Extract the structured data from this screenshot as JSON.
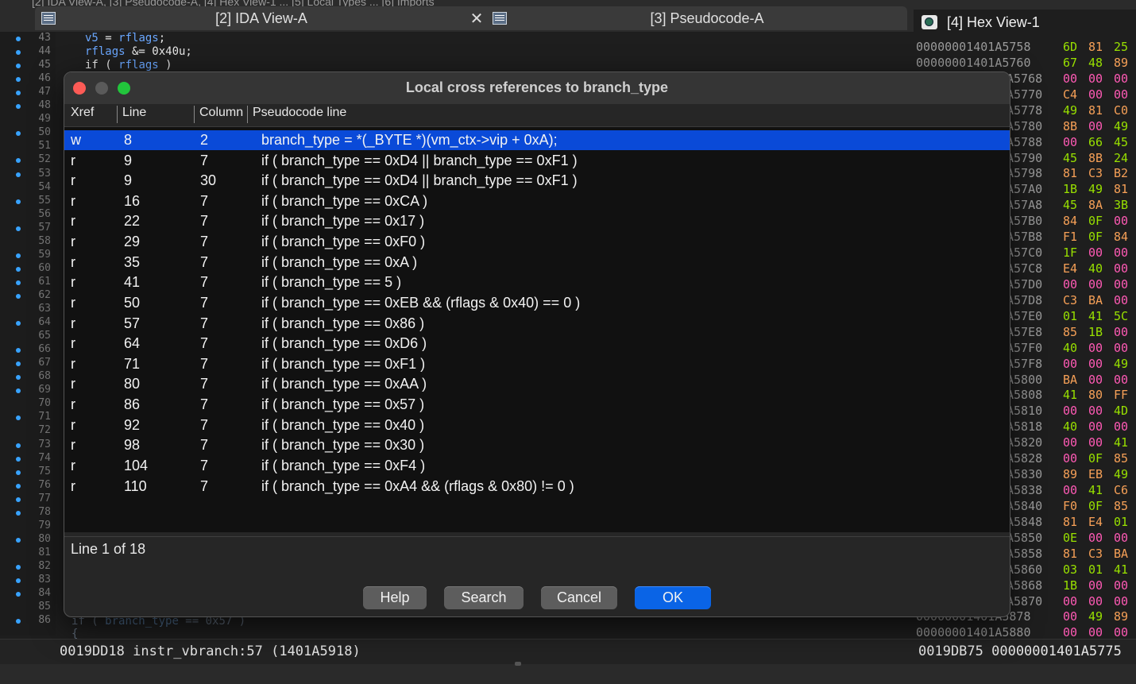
{
  "tabs": {
    "cutoff_text": "[2] IDA View-A, [3] Pseudocode-A, [4] Hex View-1  ...  [5] Local Types  ...  [6] Imports",
    "ida_view": "[2] IDA View-A",
    "pseudocode": "[3] Pseudocode-A",
    "hex_view": "[4] Hex View-1",
    "close_glyph": "✕"
  },
  "gutter": {
    "lines": [
      "43",
      "44",
      "45",
      "46",
      "47",
      "48",
      "49",
      "50",
      "51",
      "52",
      "53",
      "54",
      "55",
      "56",
      "57",
      "58",
      "59",
      "60",
      "61",
      "62",
      "63",
      "64",
      "65",
      "66",
      "67",
      "68",
      "69",
      "70",
      "71",
      "72",
      "73",
      "74",
      "75",
      "76",
      "77",
      "78",
      "79",
      "80",
      "81",
      "82",
      "83",
      "84",
      "85",
      "86"
    ],
    "breakpoints": [
      "43",
      "44",
      "45",
      "46",
      "47",
      "48",
      "50",
      "52",
      "53",
      "55",
      "57",
      "59",
      "60",
      "61",
      "62",
      "64",
      "66",
      "67",
      "68",
      "69",
      "71",
      "73",
      "74",
      "75",
      "76",
      "77",
      "78",
      "80",
      "82",
      "83",
      "84",
      "86"
    ]
  },
  "code_top": [
    {
      "parts": [
        {
          "t": "v5",
          "c": "kw"
        },
        {
          "t": " = ",
          "c": "id"
        },
        {
          "t": "rflags",
          "c": "kw"
        },
        {
          "t": ";",
          "c": "id"
        }
      ]
    },
    {
      "parts": [
        {
          "t": "rflags",
          "c": "kw"
        },
        {
          "t": " &= 0x40u;",
          "c": "id"
        }
      ]
    },
    {
      "parts": [
        {
          "t": "if ( ",
          "c": "id"
        },
        {
          "t": "rflags",
          "c": "kw"
        },
        {
          "t": " )",
          "c": "id"
        }
      ]
    }
  ],
  "code_bottom": {
    "l1_prefix": "if ( ",
    "l1_var": "branch_type",
    "l1_suffix": " == 0x57 )",
    "l2": "{"
  },
  "hex": {
    "rows": [
      {
        "addr": "00000001401A5758",
        "bytes": [
          "6D",
          "81",
          "25"
        ]
      },
      {
        "addr": "00000001401A5760",
        "bytes": [
          "67",
          "48",
          "89"
        ]
      },
      {
        "addr": "A5768",
        "bytes": [
          "00",
          "00",
          "00"
        ]
      },
      {
        "addr": "A5770",
        "bytes": [
          "C4",
          "00",
          "00"
        ]
      },
      {
        "addr": "A5778",
        "bytes": [
          "49",
          "81",
          "C0"
        ]
      },
      {
        "addr": "A5780",
        "bytes": [
          "8B",
          "00",
          "49"
        ]
      },
      {
        "addr": "A5788",
        "bytes": [
          "00",
          "66",
          "45"
        ]
      },
      {
        "addr": "A5790",
        "bytes": [
          "45",
          "8B",
          "24"
        ]
      },
      {
        "addr": "A5798",
        "bytes": [
          "81",
          "C3",
          "B2"
        ]
      },
      {
        "addr": "A57A0",
        "bytes": [
          "1B",
          "49",
          "81"
        ]
      },
      {
        "addr": "A57A8",
        "bytes": [
          "45",
          "8A",
          "3B"
        ]
      },
      {
        "addr": "A57B0",
        "bytes": [
          "84",
          "0F",
          "00"
        ]
      },
      {
        "addr": "A57B8",
        "bytes": [
          "F1",
          "0F",
          "84"
        ]
      },
      {
        "addr": "A57C0",
        "bytes": [
          "1F",
          "00",
          "00"
        ]
      },
      {
        "addr": "A57C8",
        "bytes": [
          "E4",
          "40",
          "00"
        ]
      },
      {
        "addr": "A57D0",
        "bytes": [
          "00",
          "00",
          "00"
        ]
      },
      {
        "addr": "A57D8",
        "bytes": [
          "C3",
          "BA",
          "00"
        ]
      },
      {
        "addr": "A57E0",
        "bytes": [
          "01",
          "41",
          "5C"
        ]
      },
      {
        "addr": "A57E8",
        "bytes": [
          "85",
          "1B",
          "00"
        ]
      },
      {
        "addr": "A57F0",
        "bytes": [
          "40",
          "00",
          "00"
        ]
      },
      {
        "addr": "A57F8",
        "bytes": [
          "00",
          "00",
          "49"
        ]
      },
      {
        "addr": "A5800",
        "bytes": [
          "BA",
          "00",
          "00"
        ]
      },
      {
        "addr": "A5808",
        "bytes": [
          "41",
          "80",
          "FF"
        ]
      },
      {
        "addr": "A5810",
        "bytes": [
          "00",
          "00",
          "4D"
        ]
      },
      {
        "addr": "A5818",
        "bytes": [
          "40",
          "00",
          "00"
        ]
      },
      {
        "addr": "A5820",
        "bytes": [
          "00",
          "00",
          "41"
        ]
      },
      {
        "addr": "A5828",
        "bytes": [
          "00",
          "0F",
          "85"
        ]
      },
      {
        "addr": "A5830",
        "bytes": [
          "89",
          "EB",
          "49"
        ]
      },
      {
        "addr": "A5838",
        "bytes": [
          "00",
          "41",
          "C6"
        ]
      },
      {
        "addr": "A5840",
        "bytes": [
          "F0",
          "0F",
          "85"
        ]
      },
      {
        "addr": "A5848",
        "bytes": [
          "81",
          "E4",
          "01"
        ]
      },
      {
        "addr": "A5850",
        "bytes": [
          "0E",
          "00",
          "00"
        ]
      },
      {
        "addr": "A5858",
        "bytes": [
          "81",
          "C3",
          "BA"
        ]
      },
      {
        "addr": "A5860",
        "bytes": [
          "03",
          "01",
          "41"
        ]
      },
      {
        "addr": "A5868",
        "bytes": [
          "1B",
          "00",
          "00"
        ]
      },
      {
        "addr": "A5870",
        "bytes": [
          "00",
          "00",
          "00"
        ]
      },
      {
        "addr": "00000001401A5878",
        "bytes": [
          "00",
          "49",
          "89"
        ]
      },
      {
        "addr": "00000001401A5880",
        "bytes": [
          "00",
          "00",
          "00"
        ]
      }
    ],
    "colors": {
      "printable": "#98e000",
      "zero": "#ff5ab5",
      "other": "#f6a057"
    }
  },
  "status": {
    "left": "0019DD18 instr_vbranch:57 (1401A5918)",
    "right": "0019DB75 00000001401A5775"
  },
  "dialog": {
    "title": "Local cross references to branch_type",
    "columns": {
      "xref": "Xref",
      "line": "Line",
      "column": "Column",
      "pseudo": "Pseudocode line"
    },
    "rows": [
      {
        "xref": "w",
        "line": "8",
        "col": "2",
        "code": "branch_type = *(_BYTE *)(vm_ctx->vip + 0xA);"
      },
      {
        "xref": "r",
        "line": "9",
        "col": "7",
        "code": "if ( branch_type == 0xD4 || branch_type == 0xF1 )"
      },
      {
        "xref": "r",
        "line": "9",
        "col": "30",
        "code": "if ( branch_type == 0xD4 || branch_type == 0xF1 )"
      },
      {
        "xref": "r",
        "line": "16",
        "col": "7",
        "code": "if ( branch_type == 0xCA )"
      },
      {
        "xref": "r",
        "line": "22",
        "col": "7",
        "code": "if ( branch_type == 0x17 )"
      },
      {
        "xref": "r",
        "line": "29",
        "col": "7",
        "code": "if ( branch_type == 0xF0 )"
      },
      {
        "xref": "r",
        "line": "35",
        "col": "7",
        "code": "if ( branch_type == 0xA )"
      },
      {
        "xref": "r",
        "line": "41",
        "col": "7",
        "code": "if ( branch_type == 5 )"
      },
      {
        "xref": "r",
        "line": "50",
        "col": "7",
        "code": "if ( branch_type == 0xEB && (rflags & 0x40) == 0 )"
      },
      {
        "xref": "r",
        "line": "57",
        "col": "7",
        "code": "if ( branch_type == 0x86 )"
      },
      {
        "xref": "r",
        "line": "64",
        "col": "7",
        "code": "if ( branch_type == 0xD6 )"
      },
      {
        "xref": "r",
        "line": "71",
        "col": "7",
        "code": "if ( branch_type == 0xF1 )"
      },
      {
        "xref": "r",
        "line": "80",
        "col": "7",
        "code": "if ( branch_type == 0xAA )"
      },
      {
        "xref": "r",
        "line": "86",
        "col": "7",
        "code": "if ( branch_type == 0x57 )"
      },
      {
        "xref": "r",
        "line": "92",
        "col": "7",
        "code": "if ( branch_type == 0x40 )"
      },
      {
        "xref": "r",
        "line": "98",
        "col": "7",
        "code": "if ( branch_type == 0x30 )"
      },
      {
        "xref": "r",
        "line": "104",
        "col": "7",
        "code": "if ( branch_type == 0xF4 )"
      },
      {
        "xref": "r",
        "line": "110",
        "col": "7",
        "code": "if ( branch_type == 0xA4 && (rflags & 0x80) != 0 )"
      }
    ],
    "selected_index": 0,
    "line_info": "Line 1 of 18",
    "buttons": {
      "help": "Help",
      "search": "Search",
      "cancel": "Cancel",
      "ok": "OK"
    },
    "colors": {
      "selection": "#0a4ad8",
      "ok": "#0a64e6"
    }
  }
}
